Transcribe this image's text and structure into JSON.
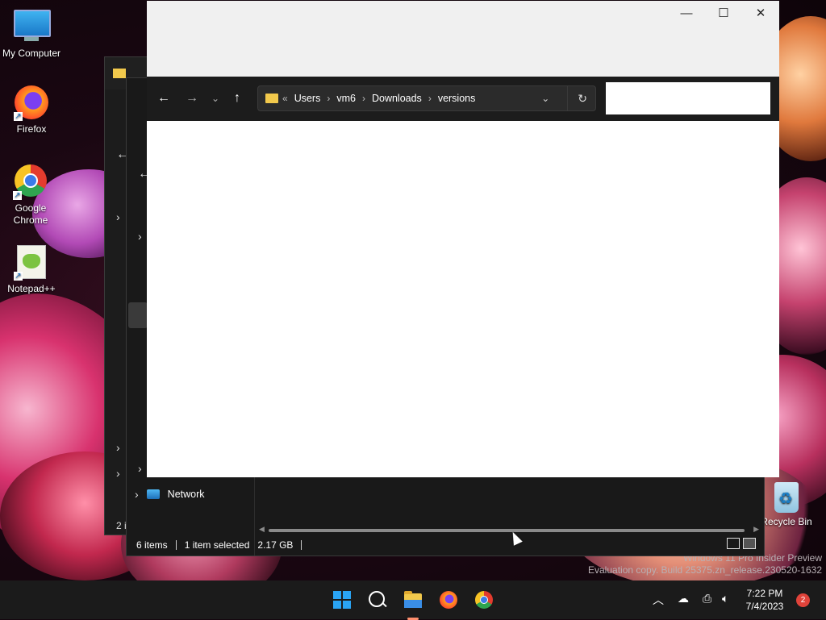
{
  "desktop": {
    "icons": [
      {
        "label": "My Computer"
      },
      {
        "label": "Firefox"
      },
      {
        "label": "Google Chrome"
      },
      {
        "label": "Notepad++"
      }
    ],
    "recycle_bin": "Recycle Bin",
    "watermark": {
      "line1": "Windows 11 Pro Insider Preview",
      "line2": "Evaluation copy. Build 25375.zn_release.230520-1632"
    }
  },
  "back_window_1": {
    "status_text": "2 i"
  },
  "back_window_2": {
    "nav_pane": {
      "network_label": "Network"
    },
    "status": {
      "items_count": "6 items",
      "selection": "1 item selected",
      "size": "2.17 GB"
    }
  },
  "front_window": {
    "breadcrumbs": [
      "Users",
      "vm6",
      "Downloads",
      "versions"
    ],
    "overflow_glyph": "«",
    "search_placeholder": ""
  },
  "taskbar": {
    "clock_time": "7:22 PM",
    "clock_date": "7/4/2023",
    "notification_count": "2"
  },
  "colors": {
    "taskbar_bg": "#1b1b1b",
    "explorer_dark": "#191919",
    "accent_blue": "#2aa4f4"
  }
}
